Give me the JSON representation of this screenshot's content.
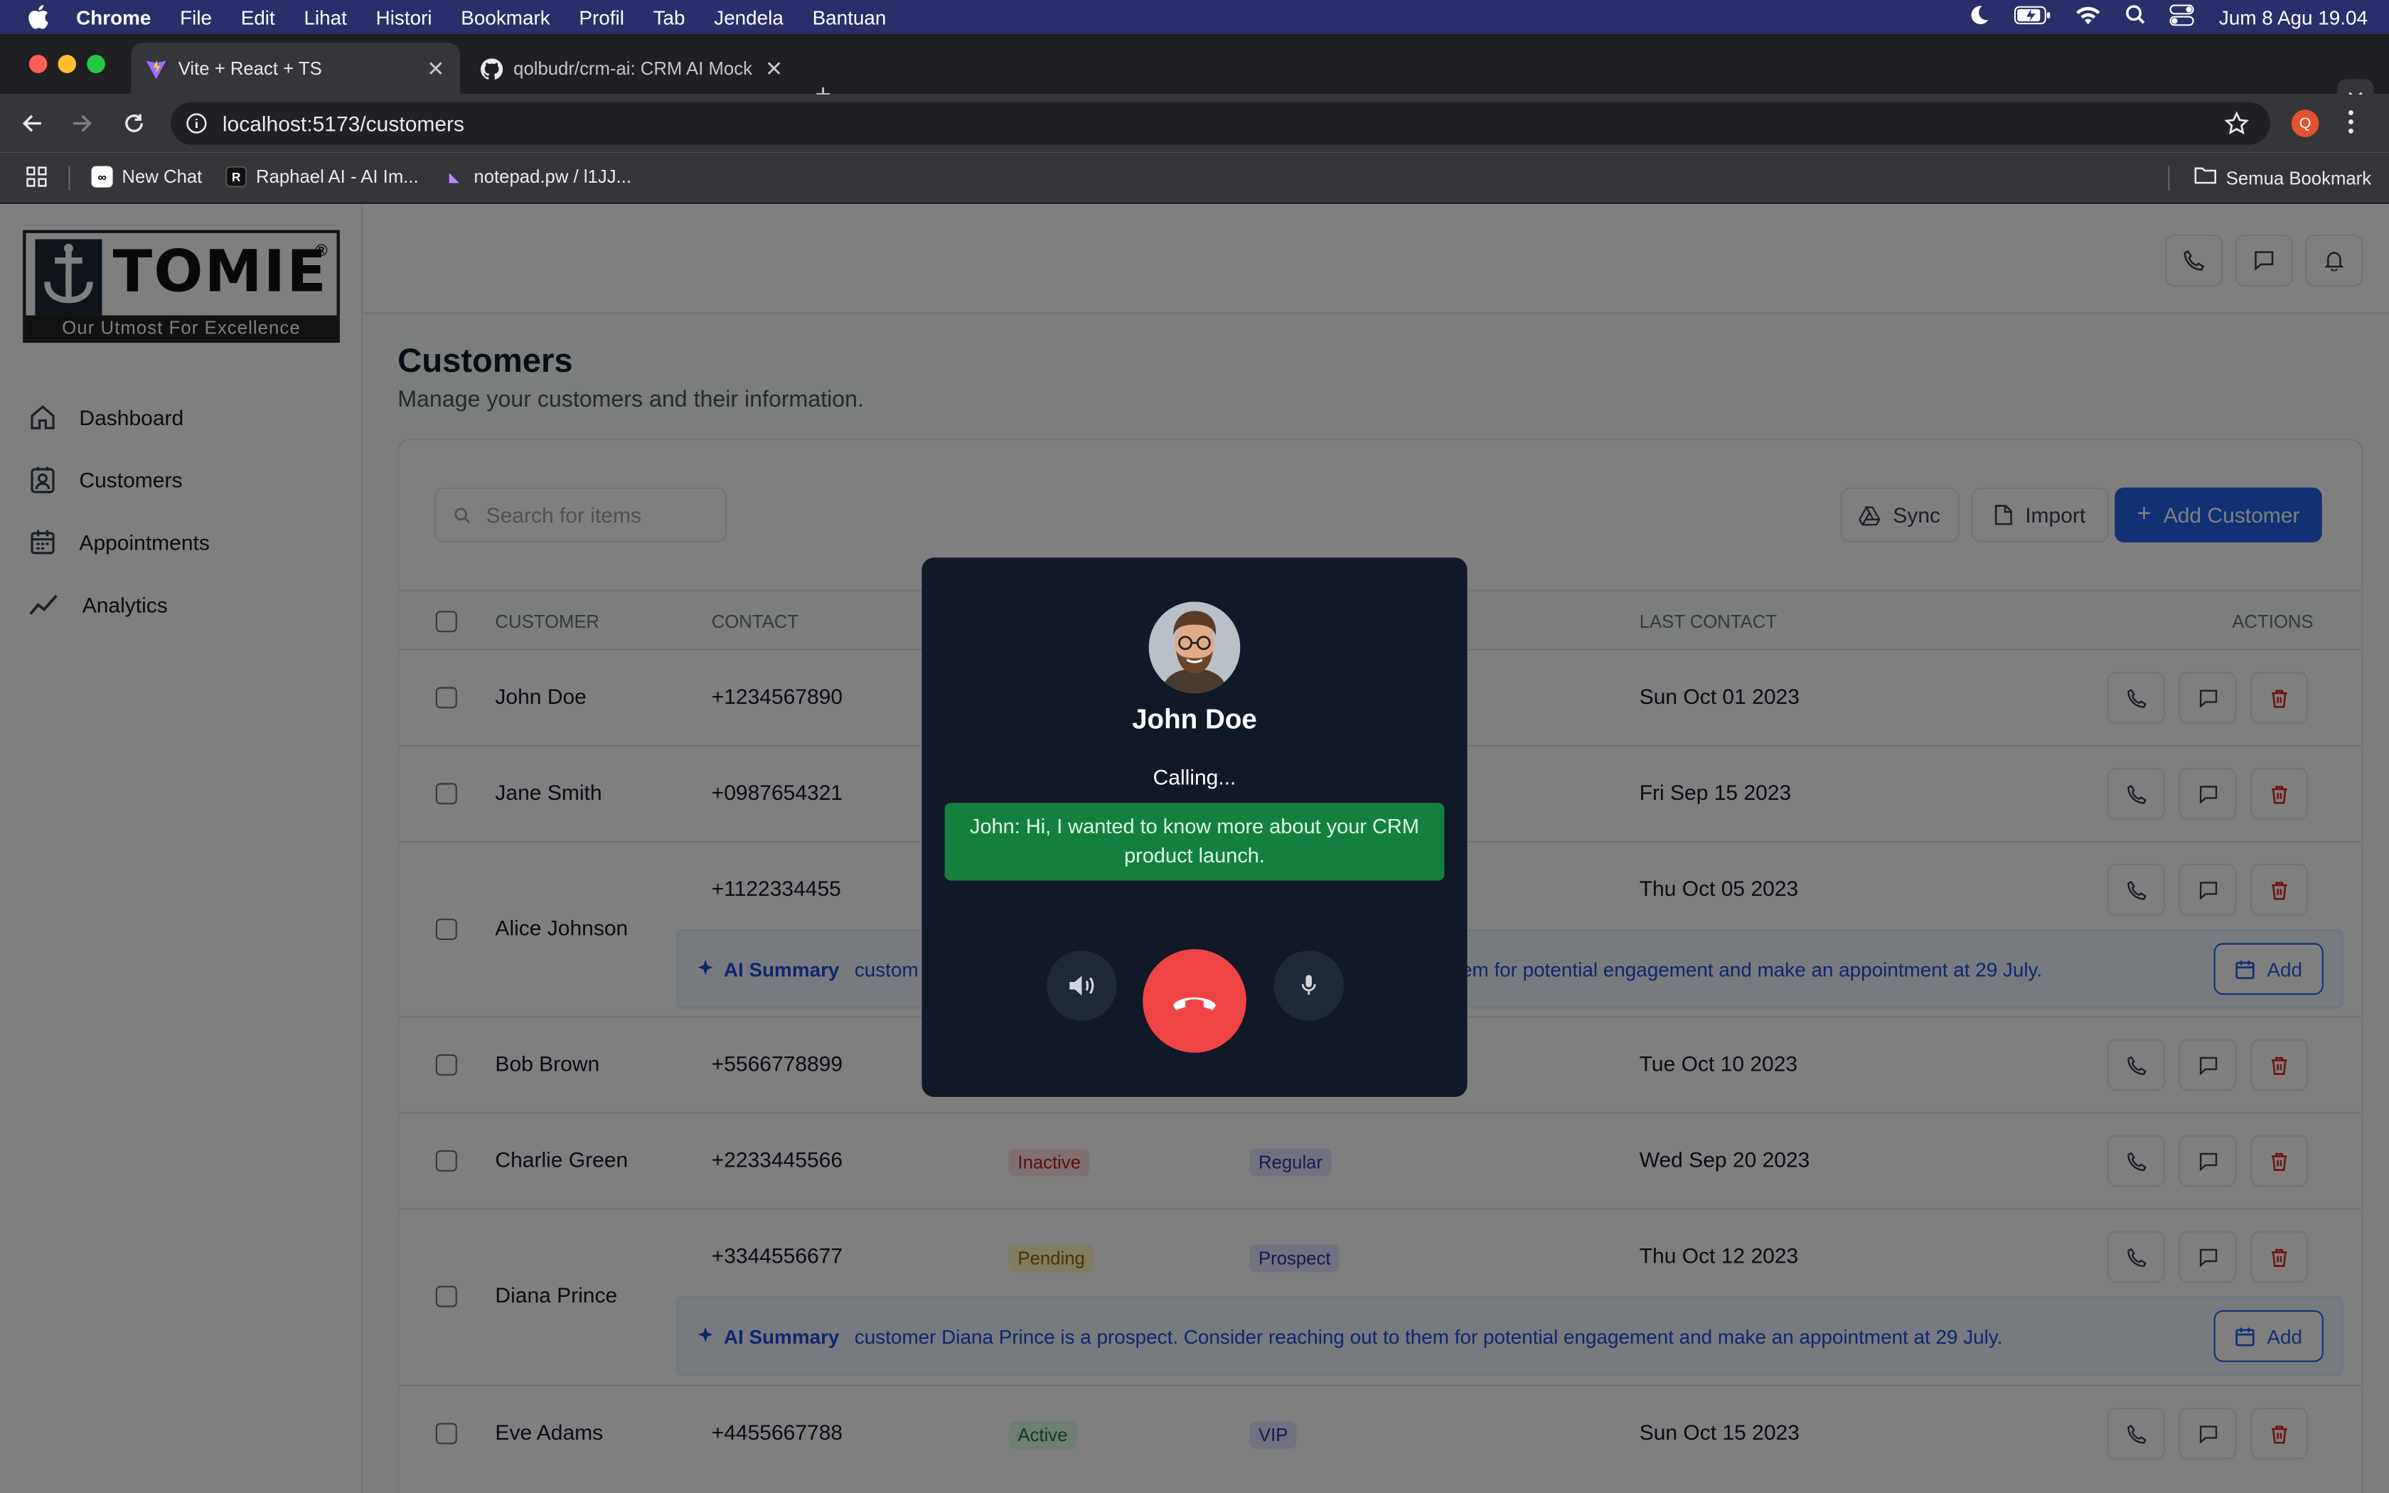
{
  "menubar": {
    "app": "Chrome",
    "items": [
      "File",
      "Edit",
      "Lihat",
      "Histori",
      "Bookmark",
      "Profil",
      "Tab",
      "Jendela",
      "Bantuan"
    ],
    "datetime": "Jum 8 Agu  19.04"
  },
  "tabs": [
    {
      "title": "Vite + React + TS",
      "active": true
    },
    {
      "title": "qolbudr/crm-ai: CRM AI Mock",
      "active": false
    }
  ],
  "address": {
    "url": "localhost:5173/customers",
    "profile_initial": "Q"
  },
  "bookmarks": {
    "items": [
      "New Chat",
      "Raphael AI - AI Im...",
      "notepad.pw / l1JJ..."
    ],
    "all_label": "Semua Bookmark"
  },
  "logo": {
    "word": "TOMIE",
    "registered": "®",
    "tagline": "Our Utmost For Excellence"
  },
  "sidebar": {
    "items": [
      {
        "label": "Dashboard",
        "icon": "home-icon"
      },
      {
        "label": "Customers",
        "icon": "contact-icon"
      },
      {
        "label": "Appointments",
        "icon": "calendar-icon"
      },
      {
        "label": "Analytics",
        "icon": "trend-icon"
      }
    ]
  },
  "page": {
    "title": "Customers",
    "subtitle": "Manage your customers and their information.",
    "search_placeholder": "Search for items",
    "sync_label": "Sync",
    "import_label": "Import",
    "add_label": "Add Customer"
  },
  "table": {
    "headers": {
      "customer": "CUSTOMER",
      "contact": "CONTACT",
      "last_contact": "LAST CONTACT",
      "actions": "ACTIONS"
    },
    "rows": [
      {
        "name": "John Doe",
        "contact": "+1234567890",
        "status": "",
        "type": "",
        "last": "Sun Oct 01 2023"
      },
      {
        "name": "Jane Smith",
        "contact": "+0987654321",
        "status": "",
        "type": "",
        "last": "Fri Sep 15 2023"
      },
      {
        "name": "Alice Johnson",
        "contact": "+1122334455",
        "status": "",
        "type": "",
        "last": "Thu Oct 05 2023"
      },
      {
        "name": "Bob Brown",
        "contact": "+5566778899",
        "status": "",
        "type": "",
        "last": "Tue Oct 10 2023"
      },
      {
        "name": "Charlie Green",
        "contact": "+2233445566",
        "status": "Inactive",
        "type": "Regular",
        "last": "Wed Sep 20 2023"
      },
      {
        "name": "Diana Prince",
        "contact": "+3344556677",
        "status": "Pending",
        "type": "Prospect",
        "last": "Thu Oct 12 2023"
      },
      {
        "name": "Eve Adams",
        "contact": "+4455667788",
        "status": "Active",
        "type": "VIP",
        "last": "Sun Oct 15 2023"
      }
    ],
    "ai_summaries": [
      {
        "label": "AI Summary",
        "text_left": "custom",
        "text_right": "em for potential engagement and make an appointment at 29 July.",
        "add_label": "Add"
      },
      {
        "label": "AI Summary",
        "text": "customer Diana Prince is a prospect. Consider reaching out to them for potential engagement and make an appointment at 29 July.",
        "add_label": "Add"
      }
    ]
  },
  "call": {
    "name": "John Doe",
    "status": "Calling...",
    "transcript": "John: Hi, I wanted to know more about your CRM product launch.",
    "colors": {
      "background": "#111827",
      "hangup": "#ef4444",
      "transcript_bg": "#15803d"
    }
  }
}
